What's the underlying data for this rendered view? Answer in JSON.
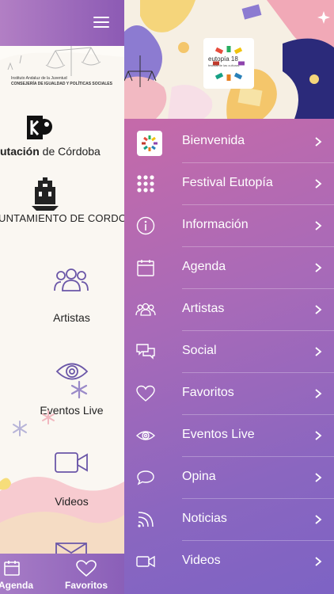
{
  "left_page": {
    "institution_line1": "Instituto Andaluz de la Juventud",
    "institution_line2": "CONSEJERÍA DE IGUALDAD Y POLÍTICAS SOCIALES",
    "diputacion_text_bold": "utación",
    "diputacion_text_rest": " de Córdoba",
    "ayuntamiento_text": "UNTAMIENTO DE CORDOBA",
    "nav_items": [
      {
        "label": "Artistas",
        "icon": "people-icon"
      },
      {
        "label": "Eventos Live",
        "icon": "eye-icon"
      },
      {
        "label": "Videos",
        "icon": "video-camera-icon"
      }
    ],
    "tabs": [
      {
        "label": "Agenda",
        "icon": "calendar-icon"
      },
      {
        "label": "Favoritos",
        "icon": "heart-icon"
      }
    ]
  },
  "drawer": {
    "header_logo_text": "eutopía 18",
    "header_logo_subtext": "festival de las culturas",
    "items": [
      {
        "label": "Bienvenida",
        "icon": "app-logo-icon"
      },
      {
        "label": "Festival Eutopía",
        "icon": "grid-dots-icon"
      },
      {
        "label": "Información",
        "icon": "info-icon"
      },
      {
        "label": "Agenda",
        "icon": "calendar-icon"
      },
      {
        "label": "Artistas",
        "icon": "people-icon"
      },
      {
        "label": "Social",
        "icon": "chat-bubbles-icon"
      },
      {
        "label": "Favoritos",
        "icon": "heart-icon"
      },
      {
        "label": "Eventos Live",
        "icon": "eye-icon"
      },
      {
        "label": "Opina",
        "icon": "speech-bubble-icon"
      },
      {
        "label": "Noticias",
        "icon": "rss-icon"
      },
      {
        "label": "Videos",
        "icon": "video-camera-icon"
      }
    ]
  },
  "colors": {
    "accent_purple": "#8c5ab4",
    "drawer_pink": "#c56aa9",
    "drawer_violet": "#7d63c4"
  }
}
